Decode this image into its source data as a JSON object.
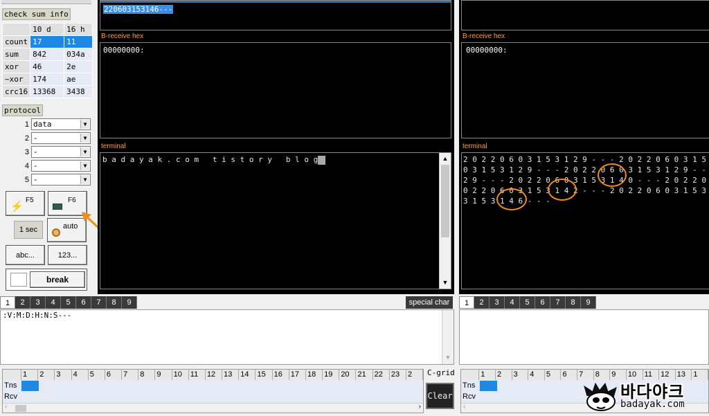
{
  "checksum": {
    "title": "check sum info",
    "col_dec": "10 d",
    "col_hex": "16 h",
    "rows": [
      {
        "name": "count",
        "dec": "17",
        "hex": "11"
      },
      {
        "name": "sum",
        "dec": "842",
        "hex": "034a"
      },
      {
        "name": "xor",
        "dec": "46",
        "hex": "2e"
      },
      {
        "name": "~xor",
        "dec": "174",
        "hex": "ae"
      },
      {
        "name": "crc16",
        "dec": "13368",
        "hex": "3438"
      }
    ]
  },
  "protocol": {
    "title": "protocol",
    "rows": [
      {
        "num": "1",
        "value": "data"
      },
      {
        "num": "2",
        "value": "-"
      },
      {
        "num": "3",
        "value": "-"
      },
      {
        "num": "4",
        "value": "-"
      },
      {
        "num": "5",
        "value": "-"
      }
    ]
  },
  "controls": {
    "f5": "F5",
    "f6": "F6",
    "interval": "1 sec",
    "auto": "auto",
    "abc": "abc...",
    "num": "123...",
    "break": "break"
  },
  "left_port": {
    "selected_line": "220603153146---",
    "hex_label": "B-receive hex",
    "hex_line": "00000000:",
    "terminal_label": "terminal",
    "terminal_text": "b a d a y a k . c o m   t i s t o r y   b l o g"
  },
  "right_port": {
    "hex_label": "B-receive hex",
    "hex_line": "00000000:",
    "terminal_label": "terminal",
    "terminal_lines": [
      "2 0 2 2 0 6 0 3 1 5 3 1 2 9 - - - 2 0 2 2 0 6 0 3 1 5 3 1 2",
      "0 3 1 5 3 1 2 9 - - - 2 0 2 2 0 6 0 3 1 5 3 1 2 9 - - - 2 0",
      "2 9 - - - 2 0 2 2 0 6 0 3 1 5 3 1 4 0 - - - 2 0 2 2 0 6 0 3",
      "0 2 2 0 6 0 3 1 5 3 1 4 2 - - - 2 0 2 2 0 6 0 3 1 5 3 1 4 4",
      "3 1 5 3 1 4 6 - - -"
    ]
  },
  "tabs": [
    "1",
    "2",
    "3",
    "4",
    "5",
    "6",
    "7",
    "8",
    "9"
  ],
  "special_char": "special char",
  "send_text": ":V:M:D:H:N:S---",
  "grid": {
    "label": "C-grid",
    "cols_left": [
      "1",
      "2",
      "3",
      "4",
      "5",
      "6",
      "7",
      "8",
      "9",
      "10",
      "11",
      "12",
      "13",
      "14",
      "15",
      "16",
      "17",
      "18",
      "19",
      "20",
      "21",
      "22",
      "23",
      "2"
    ],
    "cols_right": [
      "1",
      "2",
      "3",
      "4",
      "5",
      "6",
      "7",
      "8",
      "9",
      "10",
      "11",
      "12",
      "13",
      "1"
    ],
    "rows": [
      "Tns",
      "Rcv"
    ],
    "clear": "Clear"
  },
  "watermark": {
    "korean": "바다야크",
    "domain": "badayak.com"
  },
  "colors": {
    "accent_orange": "#f08c1a",
    "selection_blue": "#1e88e5",
    "terminal_bg": "#000000"
  }
}
